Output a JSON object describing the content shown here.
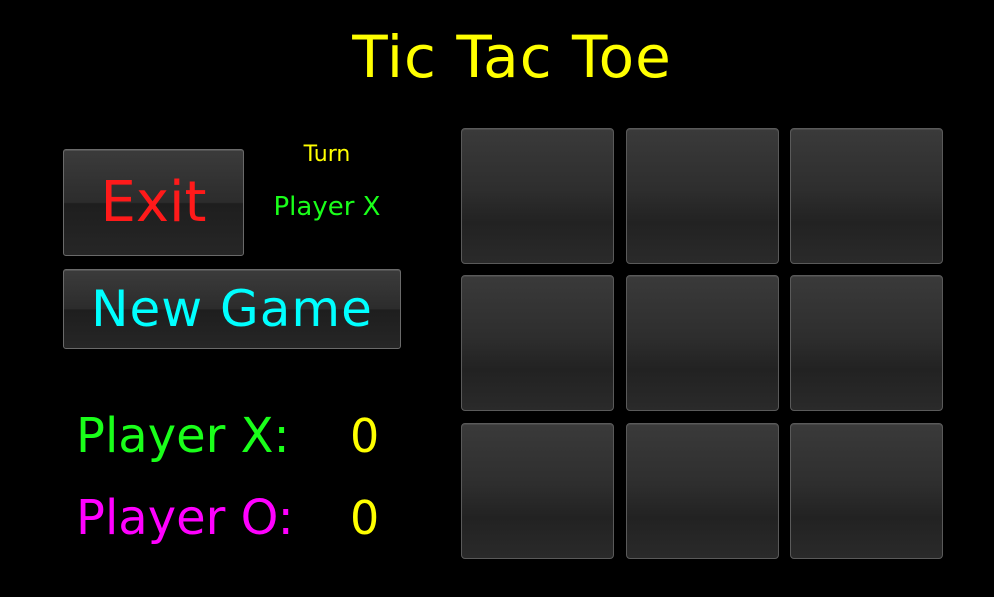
{
  "title": "Tic Tac Toe",
  "controls": {
    "exit_label": "Exit",
    "new_game_label": "New Game"
  },
  "turn": {
    "label": "Turn",
    "current_player": "Player X"
  },
  "scores": [
    {
      "label": "Player X:",
      "value": "0"
    },
    {
      "label": "Player O:",
      "value": "0"
    }
  ],
  "board": {
    "cells": [
      "",
      "",
      "",
      "",
      "",
      "",
      "",
      "",
      ""
    ]
  },
  "colors": {
    "title": "#ffff00",
    "exit": "#ff1a1a",
    "new_game": "#00ffff",
    "turn_label": "#ffff00",
    "player_x": "#1aff1a",
    "player_o": "#ff00ff",
    "score_value": "#ffff00"
  }
}
